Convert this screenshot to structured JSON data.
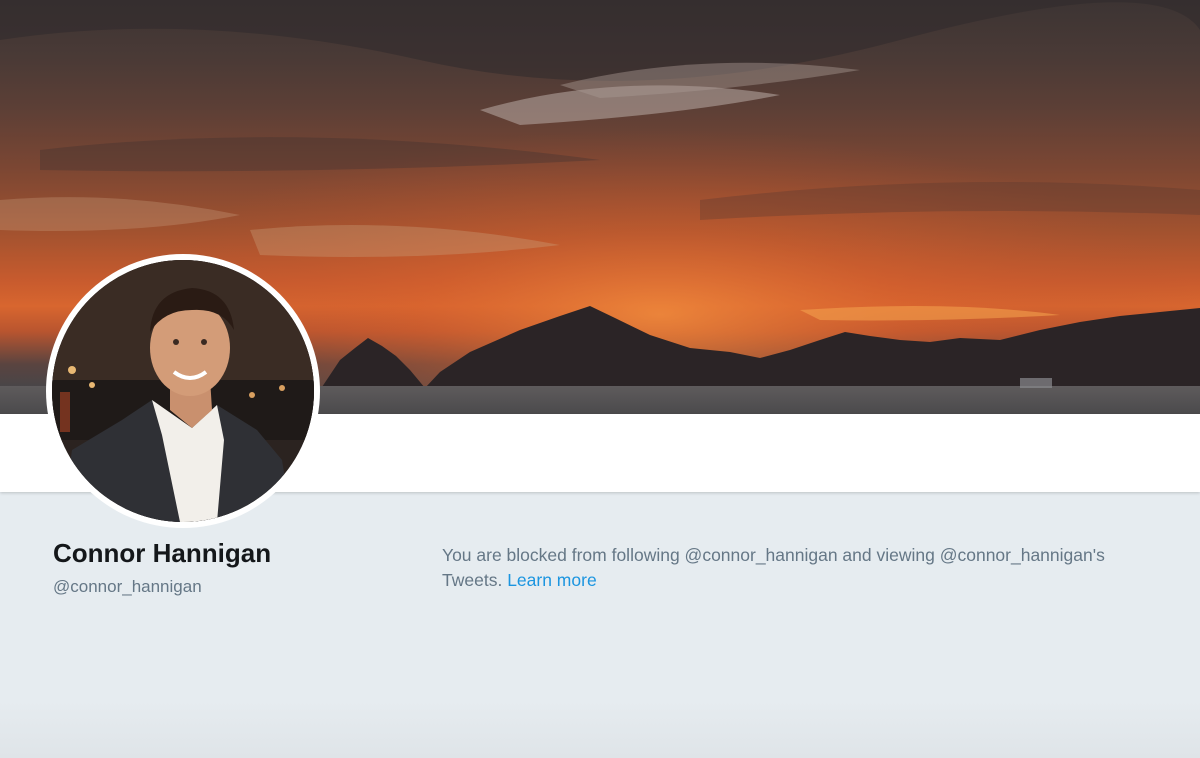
{
  "profile": {
    "name": "Connor Hannigan",
    "handle": "@connor_hannigan"
  },
  "blocked_notice": {
    "text": "You are blocked from following @connor_hannigan and viewing @connor_hannigan's Tweets.",
    "link_label": "Learn more"
  },
  "colors": {
    "page_background": "#e6ecf0",
    "link": "#1b95e0",
    "secondary_text": "#657786",
    "primary_text": "#14171a"
  }
}
